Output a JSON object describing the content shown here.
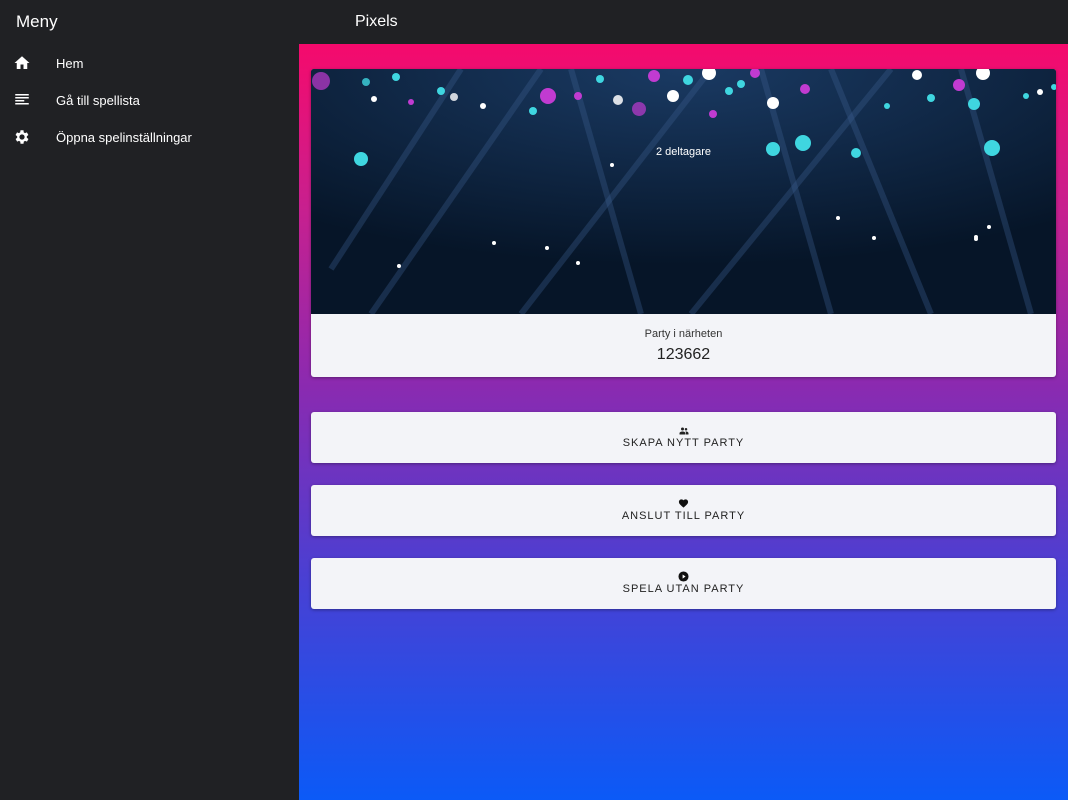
{
  "sidebar": {
    "title": "Meny",
    "items": [
      {
        "label": "Hem",
        "icon": "home-icon"
      },
      {
        "label": "Gå till spellista",
        "icon": "list-icon"
      },
      {
        "label": "Öppna spelinställningar",
        "icon": "gear-icon"
      }
    ]
  },
  "header": {
    "title": "Pixels"
  },
  "party_card": {
    "participants": "2 deltagare",
    "caption": "Party i närheten",
    "code": "123662"
  },
  "actions": [
    {
      "label": "SKAPA NYTT PARTY",
      "icon": "group-icon"
    },
    {
      "label": "ANSLUT TILL PARTY",
      "icon": "heart-icon"
    },
    {
      "label": "SPELA UTAN PARTY",
      "icon": "play-circle-icon"
    }
  ],
  "colors": {
    "sidebar_bg": "#202124",
    "gradient_top": "#f50a6c",
    "gradient_bottom": "#0b5af7",
    "card_bg": "#f3f4f8"
  }
}
